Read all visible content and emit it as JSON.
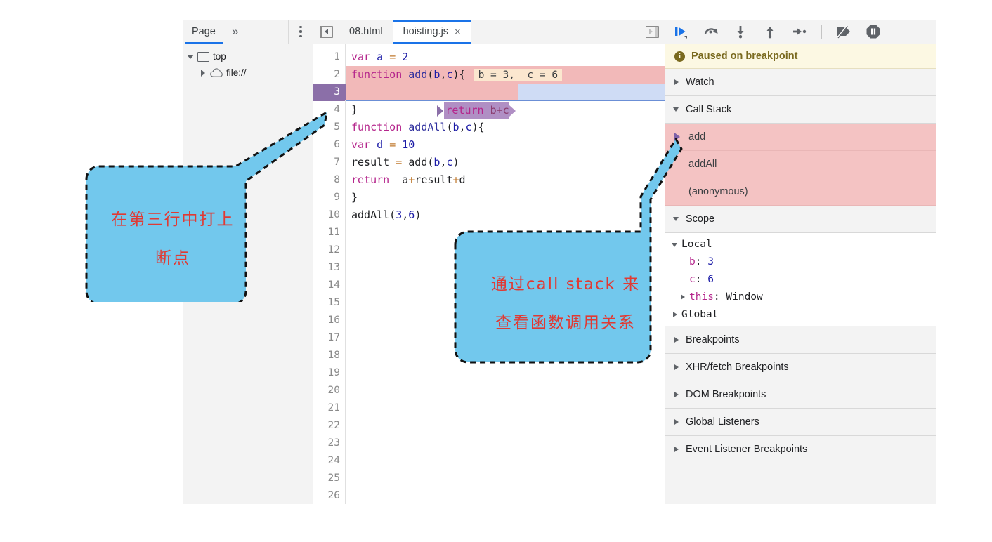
{
  "navigator": {
    "tabs": [
      {
        "label": "Page",
        "selected": true
      },
      {
        "label": "»",
        "selected": false
      }
    ],
    "kebab_icon": "more-vertical-icon",
    "tree": [
      {
        "label": "top",
        "icon": "window-icon",
        "expanded": true,
        "depth": 0
      },
      {
        "label": "file://",
        "icon": "cloud-icon",
        "expanded": false,
        "depth": 1
      }
    ]
  },
  "editor": {
    "collapse_icon": "panel-collapse-left-icon",
    "expand_icon": "panel-expand-right-icon",
    "tabs": [
      {
        "label": "08.html",
        "selected": false,
        "closable": false
      },
      {
        "label": "hoisting.js",
        "selected": true,
        "closable": true,
        "close_label": "×"
      }
    ],
    "filename": "hoisting.js",
    "line_numbers": [
      1,
      2,
      3,
      4,
      5,
      6,
      7,
      8,
      9,
      10,
      11,
      12,
      13,
      14,
      15,
      16,
      17,
      18,
      19,
      20,
      21,
      22,
      23,
      24,
      25,
      26
    ],
    "breakpoint_line": 3,
    "execution_line": 3,
    "inline_hint": "b = 3,  c = 6",
    "code": [
      {
        "n": 1,
        "text": "var a = 2"
      },
      {
        "n": 2,
        "text": "function add(b,c){"
      },
      {
        "n": 3,
        "text": "    return  b+c"
      },
      {
        "n": 4,
        "text": "}"
      },
      {
        "n": 5,
        "text": "function addAll(b,c){"
      },
      {
        "n": 6,
        "text": "var d = 10"
      },
      {
        "n": 7,
        "text": "result = add(b,c)"
      },
      {
        "n": 8,
        "text": "return  a+result+d"
      },
      {
        "n": 9,
        "text": "}"
      },
      {
        "n": 10,
        "text": "addAll(3,6)"
      }
    ]
  },
  "debugger": {
    "toolbar": [
      {
        "name": "resume-script-execution",
        "icon": "resume-icon"
      },
      {
        "name": "step-over-next-function-call",
        "icon": "step-over-icon"
      },
      {
        "name": "step-into-next-function-call",
        "icon": "step-into-icon"
      },
      {
        "name": "step-out-of-current-function",
        "icon": "step-out-icon"
      },
      {
        "name": "step",
        "icon": "step-icon"
      },
      {
        "name": "deactivate-breakpoints",
        "icon": "deactivate-breakpoints-icon"
      },
      {
        "name": "pause-on-exceptions",
        "icon": "pause-on-exceptions-icon"
      }
    ],
    "paused_banner": {
      "icon": "info-icon",
      "text": "Paused on breakpoint"
    },
    "sections": [
      {
        "label": "Watch",
        "expanded": false
      },
      {
        "label": "Call Stack",
        "expanded": true
      }
    ],
    "call_stack": [
      {
        "label": "add",
        "current": true
      },
      {
        "label": "addAll",
        "current": false
      },
      {
        "label": "(anonymous)",
        "current": false
      }
    ],
    "scope_header": {
      "label": "Scope",
      "expanded": true
    },
    "scope": [
      {
        "label": "Local",
        "kind": "group",
        "expanded": true,
        "indent": 0
      },
      {
        "name": "b",
        "value": "3",
        "kind": "prop",
        "indent": 1
      },
      {
        "name": "c",
        "value": "6",
        "kind": "prop",
        "indent": 1
      },
      {
        "name": "this",
        "value": "Window",
        "kind": "expandable",
        "indent": 1
      },
      {
        "label": "Global",
        "kind": "group",
        "expanded": false,
        "indent": 0
      }
    ],
    "bottom_sections": [
      {
        "label": "Breakpoints",
        "expanded": false
      },
      {
        "label": "XHR/fetch Breakpoints",
        "expanded": false
      },
      {
        "label": "DOM Breakpoints",
        "expanded": false
      },
      {
        "label": "Global Listeners",
        "expanded": false
      },
      {
        "label": "Event Listener Breakpoints",
        "expanded": false
      }
    ]
  },
  "annotations": [
    {
      "id": "callout-breakpoint",
      "lines": [
        "在第三行中打上",
        "断点"
      ],
      "points_to": "breakpoint-gutter-line-3",
      "fill": "#72c8ed",
      "text_color": "#e03a34",
      "border": "dashed-black"
    },
    {
      "id": "callout-call-stack",
      "lines": [
        "通过call stack 来",
        "查看函数调用关系"
      ],
      "points_to": "call-stack-section",
      "fill": "#72c8ed",
      "text_color": "#e03a34",
      "border": "dashed-black"
    }
  ],
  "colors": {
    "accent": "#1a73e8",
    "callout_fill": "#72c8ed",
    "callout_text": "#e03a34",
    "breakpoint_row": "#f2b9b9",
    "exec_row": "#cfdcf5",
    "gutter_marker": "#8b6fa8",
    "paused_banner": "#fcf8e3",
    "panel_bg": "#f3f3f3"
  }
}
